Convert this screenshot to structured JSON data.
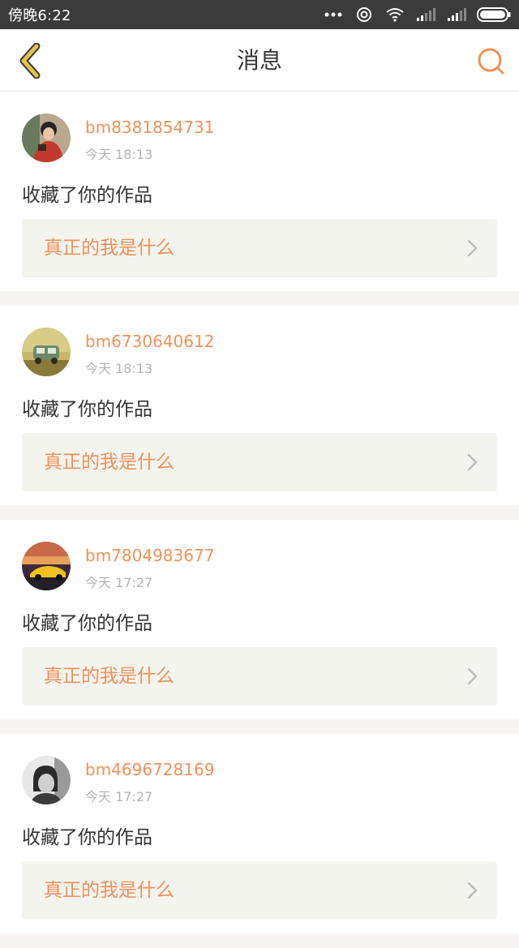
{
  "status_bar": {
    "time": "傍晚6:22",
    "icons": [
      "more-dots-icon",
      "hotspot-icon",
      "wifi-icon",
      "signal-icon",
      "signal-icon",
      "battery-icon"
    ]
  },
  "header": {
    "title": "消息",
    "back_icon": "chevron-left-icon",
    "search_icon": "search-icon",
    "accent_color": "#f0915a",
    "back_color": "#e8c24a"
  },
  "messages": [
    {
      "username": "bm8381854731",
      "time": "今天 18:13",
      "action": "收藏了你的作品",
      "work_title": "真正的我是什么",
      "avatar": "avatar-red-sweater"
    },
    {
      "username": "bm6730640612",
      "time": "今天 18:13",
      "action": "收藏了你的作品",
      "work_title": "真正的我是什么",
      "avatar": "avatar-toy-car"
    },
    {
      "username": "bm7804983677",
      "time": "今天 17:27",
      "action": "收藏了你的作品",
      "work_title": "真正的我是什么",
      "avatar": "avatar-yellow-car-sunset"
    },
    {
      "username": "bm4696728169",
      "time": "今天 17:27",
      "action": "收藏了你的作品",
      "work_title": "真正的我是什么",
      "avatar": "avatar-bw-child"
    }
  ]
}
